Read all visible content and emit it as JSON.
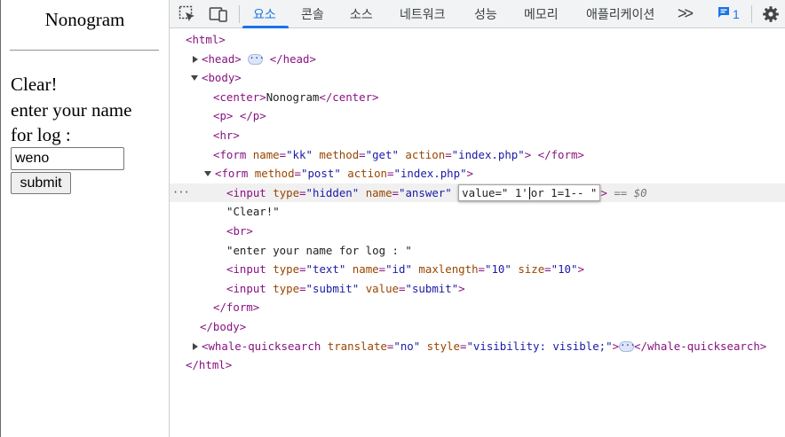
{
  "page": {
    "title": "Nonogram",
    "clear_text": "Clear!",
    "prompt_line1": "enter your name",
    "prompt_line2": "for log :",
    "name_value": "weno",
    "submit_label": "submit"
  },
  "devtools": {
    "tabs": [
      "요소",
      "콘솔",
      "소스",
      "네트워크",
      "성능",
      "메모리",
      "애플리케이션"
    ],
    "more_tabs": ">>",
    "issues_count": "1",
    "accent": "#1a73e8",
    "icons": [
      "inspect-element-icon",
      "device-toolbar-icon",
      "chevron-more-icon",
      "issues-message-icon",
      "settings-gear-icon"
    ],
    "tree": {
      "html_open": "<html>",
      "head_open": "<head>",
      "head_close": "</head>",
      "body_open": "<body>",
      "center_open": "<center>",
      "center_text": "Nonogram",
      "center_close": "</center>",
      "p_open": "<p>",
      "p_close": "</p>",
      "hr": "<hr>",
      "form1_open": "<form",
      "form1_name_attr": "name",
      "form1_name_val": "\"kk\"",
      "form1_method_attr": "method",
      "form1_method_val": "\"get\"",
      "form1_action_attr": "action",
      "form1_action_val": "\"index.php\"",
      "form1_gt": ">",
      "form1_close": "</form>",
      "form2_open": "<form",
      "form2_method_attr": "method",
      "form2_method_val": "\"post\"",
      "form2_action_attr": "action",
      "form2_action_val": "\"index.php\"",
      "form2_gt": ">",
      "input1_open": "<input",
      "input1_type_attr": "type",
      "input1_type_val": "\"hidden\"",
      "input1_name_attr": "name",
      "input1_name_val": "\"answer\"",
      "input1_value_edit_left": "value=\" 1'",
      "input1_value_edit_right": "or 1=1-- \"",
      "input1_gt": ">",
      "selected_marker": "== $0",
      "text_clear": "\"Clear!\"",
      "br": "<br>",
      "text_prompt": "\"enter your name for log : \"",
      "input2_open": "<input",
      "input2_type_attr": "type",
      "input2_type_val": "\"text\"",
      "input2_name_attr": "name",
      "input2_name_val": "\"id\"",
      "input2_maxlength_attr": "maxlength",
      "input2_maxlength_val": "\"10\"",
      "input2_size_attr": "size",
      "input2_size_val": "\"10\"",
      "input2_gt": ">",
      "input3_open": "<input",
      "input3_type_attr": "type",
      "input3_type_val": "\"submit\"",
      "input3_value_attr": "value",
      "input3_value_val": "\"submit\"",
      "input3_gt": ">",
      "form2_close": "</form>",
      "body_close": "</body>",
      "whale_open": "<whale-quicksearch",
      "whale_translate_attr": "translate",
      "whale_translate_val": "\"no\"",
      "whale_style_attr": "style",
      "whale_style_val": "\"visibility: visible;\"",
      "whale_gt": ">",
      "whale_close": "</whale-quicksearch>",
      "html_close": "</html>",
      "ellipsis": "···",
      "row_dots": "···"
    }
  }
}
